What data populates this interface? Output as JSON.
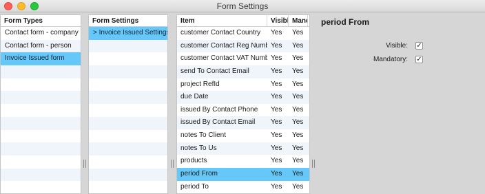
{
  "window": {
    "title": "Form Settings"
  },
  "form_types": {
    "header": "Form Types",
    "items": [
      "Contact form - company",
      "Contact form - person",
      "Invoice Issued form"
    ]
  },
  "form_settings": {
    "header": "Form Settings",
    "items": [
      "> Invoice Issued Settings"
    ]
  },
  "items_table": {
    "columns": [
      "Item",
      "Visible",
      "Mandatory"
    ],
    "rows": [
      {
        "item": "customer Contact Country",
        "visible": "Yes",
        "mandatory": "Yes"
      },
      {
        "item": "customer Contact Reg Number",
        "visible": "Yes",
        "mandatory": "Yes"
      },
      {
        "item": "customer Contact VAT Number",
        "visible": "Yes",
        "mandatory": "Yes"
      },
      {
        "item": "send To Contact Email",
        "visible": "Yes",
        "mandatory": "Yes"
      },
      {
        "item": "project RefId",
        "visible": "Yes",
        "mandatory": "Yes"
      },
      {
        "item": "due Date",
        "visible": "Yes",
        "mandatory": "Yes"
      },
      {
        "item": "issued By Contact Phone",
        "visible": "Yes",
        "mandatory": "Yes"
      },
      {
        "item": "issued By Contact Email",
        "visible": "Yes",
        "mandatory": "Yes"
      },
      {
        "item": "notes To Client",
        "visible": "Yes",
        "mandatory": "Yes"
      },
      {
        "item": "notes To Us",
        "visible": "Yes",
        "mandatory": "Yes"
      },
      {
        "item": "products",
        "visible": "Yes",
        "mandatory": "Yes"
      },
      {
        "item": "period From",
        "visible": "Yes",
        "mandatory": "Yes"
      },
      {
        "item": "period To",
        "visible": "Yes",
        "mandatory": "Yes"
      }
    ]
  },
  "details": {
    "title": "period From",
    "visible_label": "Visible:",
    "visible_check": "✓",
    "mandatory_label": "Mandatory:",
    "mandatory_check": "✓"
  },
  "colors": {
    "selection": "#66c8f8",
    "alt_row": "#f0f4fb"
  }
}
